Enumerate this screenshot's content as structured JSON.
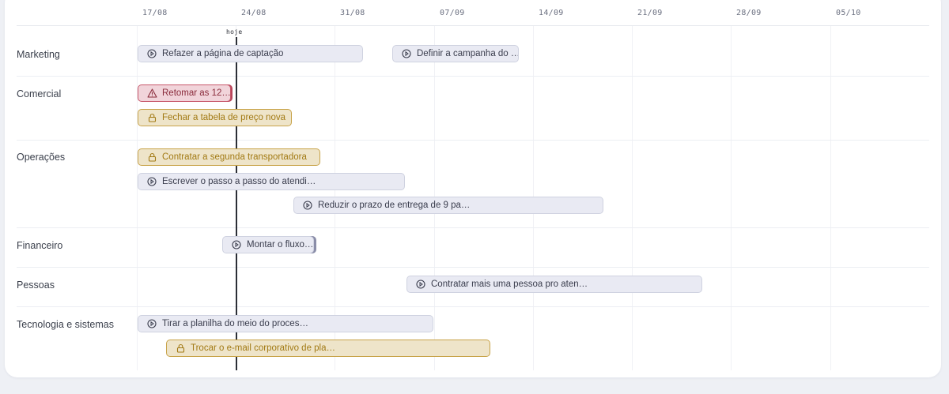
{
  "timeline": {
    "dates": [
      "17/08",
      "24/08",
      "31/08",
      "07/09",
      "14/09",
      "21/09",
      "28/09",
      "05/10"
    ],
    "today_label": "hoje"
  },
  "groups": [
    {
      "label": "Marketing"
    },
    {
      "label": "Comercial"
    },
    {
      "label": "Operações"
    },
    {
      "label": "Financeiro"
    },
    {
      "label": "Pessoas"
    },
    {
      "label": "Tecnologia e sistemas"
    }
  ],
  "tasks": {
    "mkt_1": {
      "label": "Refazer a página de captação",
      "status": "default",
      "icon": "play-circle-icon"
    },
    "mkt_2": {
      "label": "Definir a campanha do …",
      "status": "default",
      "icon": "play-circle-icon"
    },
    "com_1": {
      "label": "Retomar as 12…",
      "status": "blocked",
      "icon": "warning-icon"
    },
    "com_2": {
      "label": "Fechar a tabela de preço nova",
      "status": "locked",
      "icon": "lock-icon"
    },
    "ops_1": {
      "label": "Contratar a segunda transportadora",
      "status": "locked",
      "icon": "lock-icon"
    },
    "ops_2": {
      "label": "Escrever o passo a passo do atendi…",
      "status": "default",
      "icon": "play-circle-icon"
    },
    "ops_3": {
      "label": "Reduzir o prazo de entrega de 9 pa…",
      "status": "default",
      "icon": "play-circle-icon"
    },
    "fin_1": {
      "label": "Montar o fluxo…",
      "status": "default",
      "icon": "play-circle-icon"
    },
    "pes_1": {
      "label": "Contratar mais uma pessoa pro aten…",
      "status": "default",
      "icon": "play-circle-icon"
    },
    "tec_1": {
      "label": "Tirar a planilha do meio do proces…",
      "status": "default",
      "icon": "play-circle-icon"
    },
    "tec_2": {
      "label": "Trocar o e-mail corporativo de pla…",
      "status": "locked",
      "icon": "lock-icon"
    }
  },
  "colors": {
    "default_bar": "#e9eaf3",
    "blocked_bar": "#f1d4da",
    "locked_bar": "#eee4c9",
    "today_line": "#2b2e36"
  }
}
